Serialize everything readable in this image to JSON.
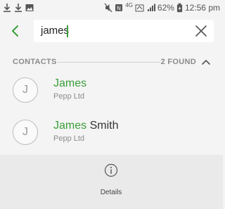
{
  "status_bar": {
    "battery": "62%",
    "time": "12:56 pm",
    "network": "4G"
  },
  "search": {
    "query": "james"
  },
  "section": {
    "title": "CONTACTS",
    "count": "2 FOUND"
  },
  "contacts": [
    {
      "initial": "J",
      "name_match": "James",
      "name_rest": "",
      "company": "Pepp Ltd"
    },
    {
      "initial": "J",
      "name_match": "James",
      "name_rest": " Smith",
      "company": "Pepp Ltd"
    }
  ],
  "bottom": {
    "details_label": "Details"
  },
  "colors": {
    "accent": "#3a9e3a",
    "background": "#f4f4f4"
  }
}
